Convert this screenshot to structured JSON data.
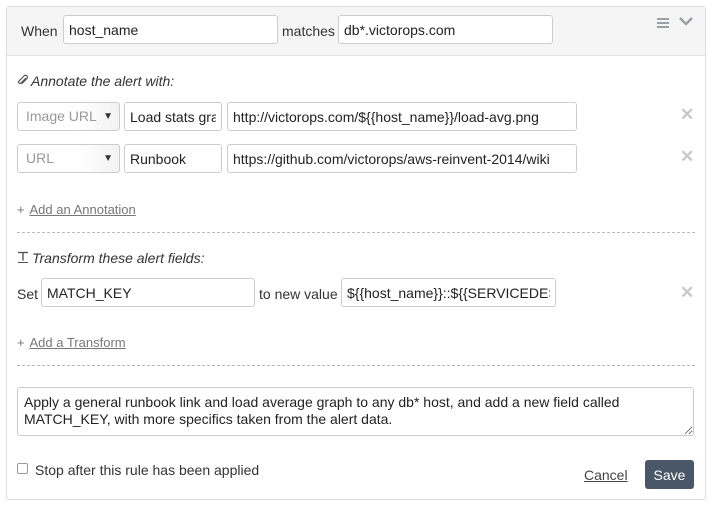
{
  "rule": {
    "when_label": "When",
    "when_field": "host_name",
    "matches_label": "matches",
    "match_pattern": "db*.victorops.com",
    "menu_icon": "hamburger-icon",
    "collapse_icon": "chevron-down-icon"
  },
  "annotations": {
    "section_title": "Annotate the alert with:",
    "section_icon": "paperclip-icon",
    "items": [
      {
        "type": "Image URL",
        "label": "Load stats graph",
        "value": "http://victorops.com/${{host_name}}/load-avg.png"
      },
      {
        "type": "URL",
        "label": "Runbook",
        "value": "https://github.com/victorops/aws-reinvent-2014/wiki"
      }
    ],
    "add_prefix": "+",
    "add_label": "Add an Annotation"
  },
  "transforms": {
    "section_title": "Transform these alert fields:",
    "section_icon": "text-transform-icon",
    "set_label": "Set",
    "field": "MATCH_KEY",
    "to_label": "to new value",
    "value": "${{host_name}}::${{SERVICEDESC}}",
    "add_prefix": "+",
    "add_label": "Add a Transform"
  },
  "description": "Apply a general runbook link and load average graph to any db* host, and add a new field called MATCH_KEY, with more specifics taken from the alert data.",
  "footer": {
    "stop_label": "Stop after this rule has been applied",
    "stop_checked": false,
    "cancel_label": "Cancel",
    "save_label": "Save"
  },
  "colors": {
    "save_button": "#4a5768",
    "header_bg": "#f5f5f5",
    "remove_icon": "#c8c8c8"
  }
}
